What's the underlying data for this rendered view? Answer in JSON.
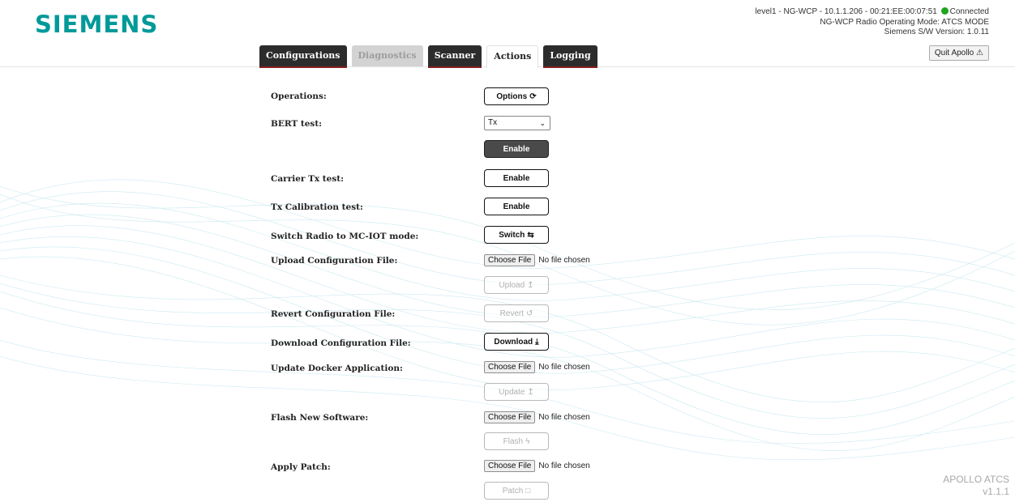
{
  "brand": "SIEMENS",
  "status": {
    "line1": "level1 - NG-WCP - 10.1.1.206 - 00:21:EE:00:07:51",
    "connection": "Connected",
    "line2": "NG-WCP Radio Operating Mode: ATCS MODE",
    "line3": "Siemens S/W Version: 1.0.11",
    "connection_color": "#1ea51e"
  },
  "quit_label": "Quit Apollo",
  "tabs": [
    {
      "label": "Configurations",
      "state": "normal"
    },
    {
      "label": "Diagnostics",
      "state": "disabled"
    },
    {
      "label": "Scanner",
      "state": "normal"
    },
    {
      "label": "Actions",
      "state": "active"
    },
    {
      "label": "Logging",
      "state": "normal"
    }
  ],
  "actions": {
    "operations": {
      "label": "Operations:",
      "button": "Options"
    },
    "bert": {
      "label": "BERT test:",
      "select_value": "Tx",
      "button": "Enable"
    },
    "carrier": {
      "label": "Carrier Tx test:",
      "button": "Enable"
    },
    "calibration": {
      "label": "Tx Calibration test:",
      "button": "Enable"
    },
    "switch_mode": {
      "label": "Switch Radio to MC-IOT mode:",
      "button": "Switch"
    },
    "upload": {
      "label": "Upload Configuration File:",
      "choose": "Choose File",
      "nofile": "No file chosen",
      "button": "Upload"
    },
    "revert": {
      "label": "Revert Configuration File:",
      "button": "Revert"
    },
    "download": {
      "label": "Download Configuration File:",
      "button": "Download"
    },
    "docker": {
      "label": "Update Docker Application:",
      "choose": "Choose File",
      "nofile": "No file chosen",
      "button": "Update"
    },
    "flash": {
      "label": "Flash New Software:",
      "choose": "Choose File",
      "nofile": "No file chosen",
      "button": "Flash"
    },
    "patch": {
      "label": "Apply Patch:",
      "choose": "Choose File",
      "nofile": "No file chosen",
      "button": "Patch"
    }
  },
  "footer": {
    "line1": "APOLLO ATCS",
    "line2": "v1.1.1"
  },
  "colors": {
    "brand": "#009999",
    "tab_dark": "#2c2c2c",
    "tab_underline": "#8a1f1f"
  }
}
